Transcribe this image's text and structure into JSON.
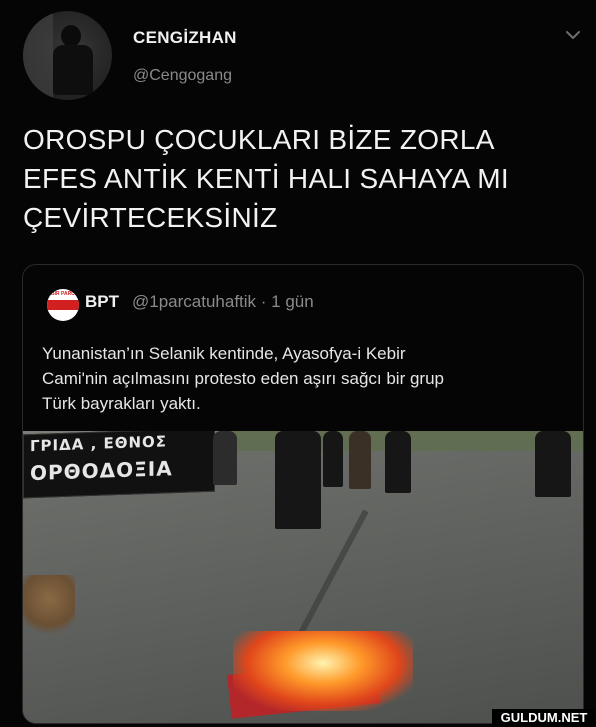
{
  "author": {
    "display_name": "CENGİZHAN",
    "handle": "@Cengogang"
  },
  "tweet": {
    "text_lines": [
      "OROSPU ÇOCUKLARI BİZE ZORLA",
      "EFES ANTİK KENTİ HALI SAHAYA MI",
      "ÇEVİRTECEKSİNİZ"
    ]
  },
  "quoted_tweet": {
    "name": "BPT",
    "handle_time": "@1parcatuhaftik · 1 gün",
    "text_lines": [
      "Yunanistan’ın Selanik kentinde, Ayasofya-i Kebir",
      "Cami'nin açılmasını protesto eden aşırı sağcı bir grup",
      "Türk bayrakları yaktı."
    ],
    "media_banner_lines": [
      "ΓΡΙΔΑ , ΕΘΝΟΣ",
      "ΟΡΘΟΔΟΞΙΑ"
    ]
  },
  "watermark": "GULDUM.NET",
  "icons": {
    "menu": "chevron-down-icon",
    "quoted_avatar": "bpt-logo-icon"
  }
}
